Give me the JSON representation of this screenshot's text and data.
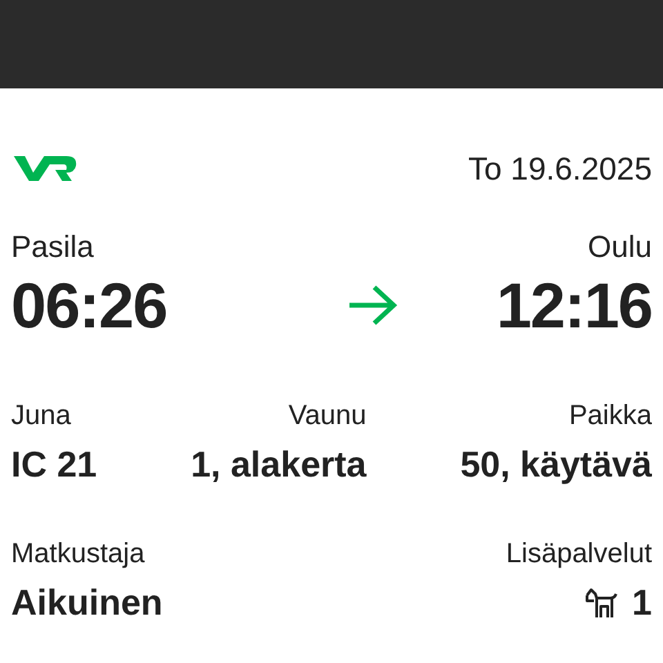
{
  "date": "To 19.6.2025",
  "departure": {
    "station": "Pasila",
    "time": "06:26"
  },
  "arrival": {
    "station": "Oulu",
    "time": "12:16"
  },
  "details": [
    {
      "label": "Juna",
      "value": "IC 21"
    },
    {
      "label": "Vaunu",
      "value": "1, alakerta"
    },
    {
      "label": "Paikka",
      "value": "50, käytävä"
    }
  ],
  "passenger": {
    "label": "Matkustaja",
    "value": "Aikuinen"
  },
  "extras": {
    "label": "Lisäpalvelut",
    "count": "1"
  }
}
